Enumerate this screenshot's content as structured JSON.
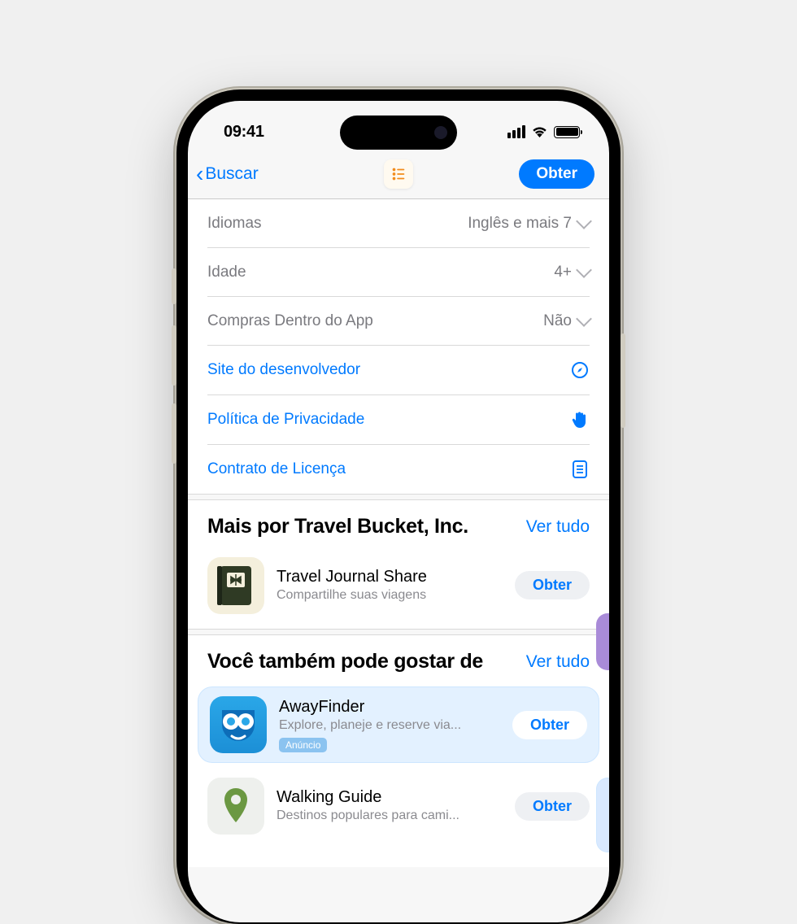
{
  "status_bar": {
    "time": "09:41"
  },
  "nav": {
    "back_label": "Buscar",
    "get_label": "Obter"
  },
  "info_rows": {
    "languages": {
      "label": "Idiomas",
      "value": "Inglês e mais 7"
    },
    "age": {
      "label": "Idade",
      "value": "4+"
    },
    "iap": {
      "label": "Compras Dentro do App",
      "value": "Não"
    }
  },
  "links": {
    "developer_site": "Site do desenvolvedor",
    "privacy_policy": "Política de Privacidade",
    "license": "Contrato de Licença"
  },
  "more_by": {
    "title": "Mais por Travel Bucket, Inc.",
    "see_all": "Ver tudo",
    "apps": [
      {
        "name": "Travel Journal Share",
        "subtitle": "Compartilhe suas viagens",
        "get": "Obter"
      }
    ]
  },
  "you_might_like": {
    "title": "Você também pode gostar de",
    "see_all": "Ver tudo",
    "apps": [
      {
        "name": "AwayFinder",
        "subtitle": "Explore, planeje e reserve via...",
        "ad_badge": "Anúncio",
        "get": "Obter"
      },
      {
        "name": "Walking Guide",
        "subtitle": "Destinos populares para cami...",
        "get": "Obter"
      }
    ]
  }
}
